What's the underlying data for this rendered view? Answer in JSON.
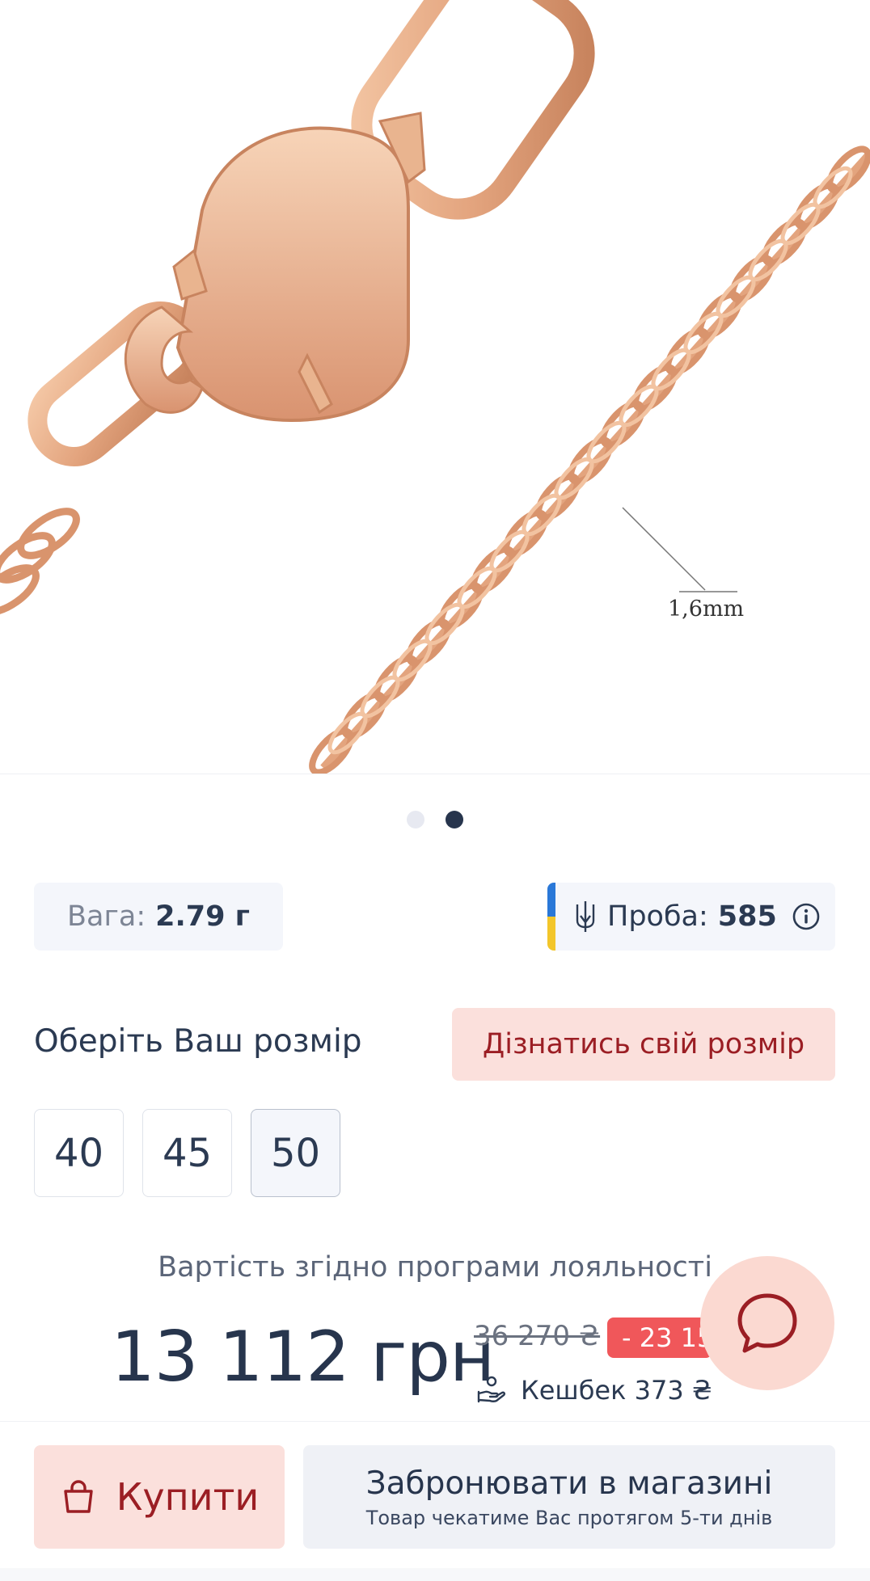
{
  "product": {
    "image_alt": "chain-clasp-photo",
    "measure_label": "1,6mm",
    "gallery_dots": 2,
    "gallery_active_index": 1
  },
  "specs": {
    "weight_label": "Вага:",
    "weight_value": "2.79 г",
    "probe_label": "Проба:",
    "probe_value": "585"
  },
  "size": {
    "title": "Оберіть Ваш розмір",
    "help_button": "Дізнатись свій розмір",
    "options": [
      "40",
      "45",
      "50"
    ],
    "selected": "50"
  },
  "pricing": {
    "loyalty_label": "Вартість згідно програми лояльності",
    "price": "13 112 грн",
    "old_price": "36 270 ₴",
    "discount": "- 23 158 ₴",
    "cashback": "Кешбек 373 ₴"
  },
  "actions": {
    "buy_label": "Купити",
    "reserve_label": "Забронювати в магазині",
    "reserve_sub": "Товар чекатиме Вас протягом 5-ти днів"
  },
  "colors": {
    "accent_bg": "#fbe0dc",
    "accent_text": "#9b1e24",
    "discount_bg": "#f0575a",
    "dark_text": "#27354d",
    "gold": "#e3a47e"
  },
  "icons": {
    "chat": "chat-bubble-icon",
    "bag": "shopping-bag-icon",
    "info": "info-icon",
    "trident": "trident-icon",
    "cashback": "cashback-hand-icon"
  }
}
